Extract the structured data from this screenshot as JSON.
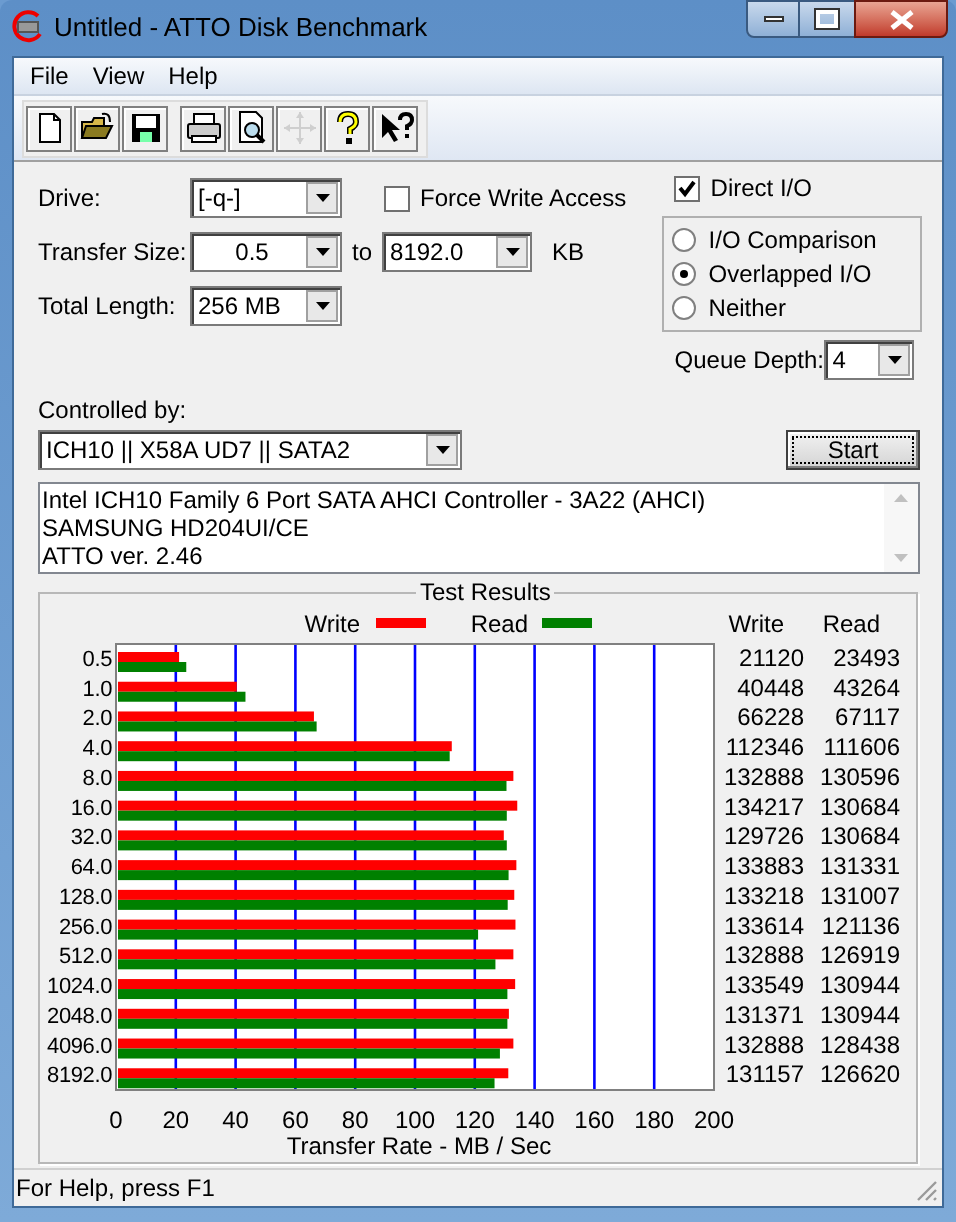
{
  "window": {
    "title": "Untitled - ATTO Disk Benchmark"
  },
  "menu": [
    {
      "label": "File"
    },
    {
      "label": "View"
    },
    {
      "label": "Help"
    }
  ],
  "toolbar": [
    {
      "kind": "new",
      "disabled": false
    },
    {
      "kind": "open",
      "disabled": false
    },
    {
      "kind": "save",
      "disabled": false
    },
    {
      "kind": "print",
      "disabled": false
    },
    {
      "kind": "preview",
      "disabled": false
    },
    {
      "kind": "move",
      "disabled": true
    },
    {
      "kind": "help",
      "disabled": false
    },
    {
      "kind": "context_help",
      "disabled": false
    }
  ],
  "drive": {
    "label": "Drive:",
    "value": "[-q-]"
  },
  "transfer_size": {
    "label": "Transfer Size:",
    "from": "0.5",
    "to_label": "to",
    "to": "8192.0",
    "unit": "KB"
  },
  "total_length": {
    "label": "Total Length:",
    "value": "256 MB"
  },
  "force_write_access": {
    "label": "Force Write Access",
    "checked": false
  },
  "direct_io": {
    "label": "Direct I/O",
    "checked": true
  },
  "io_mode": [
    {
      "label": "I/O Comparison",
      "selected": false
    },
    {
      "label": "Overlapped I/O",
      "selected": true
    },
    {
      "label": "Neither",
      "selected": false
    }
  ],
  "queue_depth": {
    "label": "Queue Depth:",
    "value": "4"
  },
  "controlled_by": {
    "label": "Controlled by:",
    "value": "ICH10  ||  X58A UD7  ||  SATA2"
  },
  "start_button": {
    "label": "Start"
  },
  "info_lines": [
    "Intel ICH10 Family 6 Port SATA AHCI Controller - 3A22 (AHCI)",
    "SAMSUNG HD204UI/CE",
    "ATTO ver. 2.46"
  ],
  "test_results": {
    "title": "Test Results",
    "chart_data": {
      "type": "bar",
      "orientation": "horizontal",
      "xlabel": "Transfer Rate - MB / Sec",
      "xlim": [
        0,
        200
      ],
      "xticks": [
        0,
        20,
        40,
        60,
        80,
        100,
        120,
        140,
        160,
        180,
        200
      ],
      "grid": true,
      "legend": true,
      "categories": [
        "0.5",
        "1.0",
        "2.0",
        "4.0",
        "8.0",
        "16.0",
        "32.0",
        "64.0",
        "128.0",
        "256.0",
        "512.0",
        "1024.0",
        "2048.0",
        "4096.0",
        "8192.0"
      ],
      "series": [
        {
          "name": "Write",
          "color": "#ff0000",
          "values": [
            21.1,
            40.4,
            66.2,
            112.3,
            132.9,
            134.2,
            129.7,
            133.9,
            133.2,
            133.6,
            132.9,
            133.5,
            131.4,
            132.9,
            131.2
          ]
        },
        {
          "name": "Read",
          "color": "#008000",
          "values": [
            23.5,
            43.3,
            67.1,
            111.6,
            130.6,
            130.7,
            130.7,
            131.3,
            131.0,
            121.1,
            126.9,
            130.9,
            130.9,
            128.4,
            126.6
          ]
        }
      ]
    },
    "table": {
      "columns": [
        "Write",
        "Read"
      ],
      "rows": [
        [
          "21120",
          "23493"
        ],
        [
          "40448",
          "43264"
        ],
        [
          "66228",
          "67117"
        ],
        [
          "112346",
          "111606"
        ],
        [
          "132888",
          "130596"
        ],
        [
          "134217",
          "130684"
        ],
        [
          "129726",
          "130684"
        ],
        [
          "133883",
          "131331"
        ],
        [
          "133218",
          "131007"
        ],
        [
          "133614",
          "121136"
        ],
        [
          "132888",
          "126919"
        ],
        [
          "133549",
          "130944"
        ],
        [
          "131371",
          "130944"
        ],
        [
          "132888",
          "128438"
        ],
        [
          "131157",
          "126620"
        ]
      ]
    }
  },
  "status_bar": {
    "text": "For Help, press F1"
  }
}
